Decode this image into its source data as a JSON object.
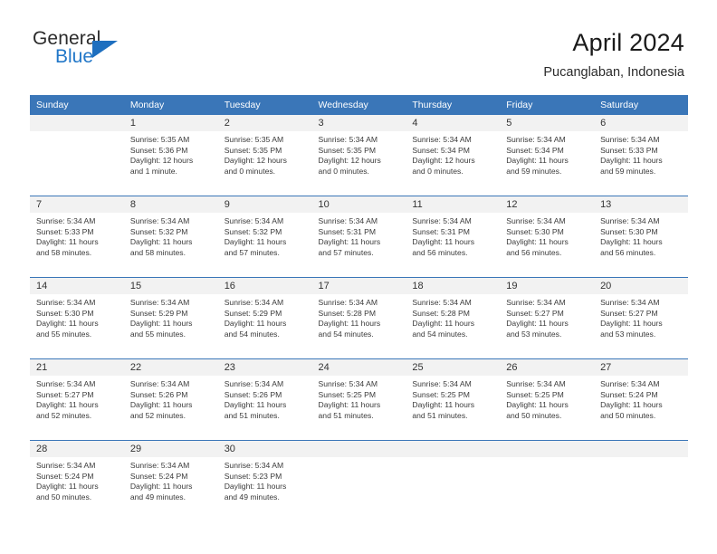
{
  "logo": {
    "word1": "General",
    "word2": "Blue",
    "triangle_color": "#1e6fbf",
    "blue_color": "#2277c8"
  },
  "header": {
    "title": "April 2024",
    "location": "Pucanglaban, Indonesia"
  },
  "theme": {
    "header_blue": "#3a76b8",
    "daynum_band": "#f2f2f2",
    "text": "#3a3a3a"
  },
  "weekday_headers": [
    "Sunday",
    "Monday",
    "Tuesday",
    "Wednesday",
    "Thursday",
    "Friday",
    "Saturday"
  ],
  "weeks": [
    [
      {
        "day": "",
        "blank": true,
        "sunrise": "",
        "sunset": "",
        "daylight1": "",
        "daylight2": ""
      },
      {
        "day": "1",
        "sunrise": "Sunrise: 5:35 AM",
        "sunset": "Sunset: 5:36 PM",
        "daylight1": "Daylight: 12 hours",
        "daylight2": "and 1 minute."
      },
      {
        "day": "2",
        "sunrise": "Sunrise: 5:35 AM",
        "sunset": "Sunset: 5:35 PM",
        "daylight1": "Daylight: 12 hours",
        "daylight2": "and 0 minutes."
      },
      {
        "day": "3",
        "sunrise": "Sunrise: 5:34 AM",
        "sunset": "Sunset: 5:35 PM",
        "daylight1": "Daylight: 12 hours",
        "daylight2": "and 0 minutes."
      },
      {
        "day": "4",
        "sunrise": "Sunrise: 5:34 AM",
        "sunset": "Sunset: 5:34 PM",
        "daylight1": "Daylight: 12 hours",
        "daylight2": "and 0 minutes."
      },
      {
        "day": "5",
        "sunrise": "Sunrise: 5:34 AM",
        "sunset": "Sunset: 5:34 PM",
        "daylight1": "Daylight: 11 hours",
        "daylight2": "and 59 minutes."
      },
      {
        "day": "6",
        "sunrise": "Sunrise: 5:34 AM",
        "sunset": "Sunset: 5:33 PM",
        "daylight1": "Daylight: 11 hours",
        "daylight2": "and 59 minutes."
      }
    ],
    [
      {
        "day": "7",
        "sunrise": "Sunrise: 5:34 AM",
        "sunset": "Sunset: 5:33 PM",
        "daylight1": "Daylight: 11 hours",
        "daylight2": "and 58 minutes."
      },
      {
        "day": "8",
        "sunrise": "Sunrise: 5:34 AM",
        "sunset": "Sunset: 5:32 PM",
        "daylight1": "Daylight: 11 hours",
        "daylight2": "and 58 minutes."
      },
      {
        "day": "9",
        "sunrise": "Sunrise: 5:34 AM",
        "sunset": "Sunset: 5:32 PM",
        "daylight1": "Daylight: 11 hours",
        "daylight2": "and 57 minutes."
      },
      {
        "day": "10",
        "sunrise": "Sunrise: 5:34 AM",
        "sunset": "Sunset: 5:31 PM",
        "daylight1": "Daylight: 11 hours",
        "daylight2": "and 57 minutes."
      },
      {
        "day": "11",
        "sunrise": "Sunrise: 5:34 AM",
        "sunset": "Sunset: 5:31 PM",
        "daylight1": "Daylight: 11 hours",
        "daylight2": "and 56 minutes."
      },
      {
        "day": "12",
        "sunrise": "Sunrise: 5:34 AM",
        "sunset": "Sunset: 5:30 PM",
        "daylight1": "Daylight: 11 hours",
        "daylight2": "and 56 minutes."
      },
      {
        "day": "13",
        "sunrise": "Sunrise: 5:34 AM",
        "sunset": "Sunset: 5:30 PM",
        "daylight1": "Daylight: 11 hours",
        "daylight2": "and 56 minutes."
      }
    ],
    [
      {
        "day": "14",
        "sunrise": "Sunrise: 5:34 AM",
        "sunset": "Sunset: 5:30 PM",
        "daylight1": "Daylight: 11 hours",
        "daylight2": "and 55 minutes."
      },
      {
        "day": "15",
        "sunrise": "Sunrise: 5:34 AM",
        "sunset": "Sunset: 5:29 PM",
        "daylight1": "Daylight: 11 hours",
        "daylight2": "and 55 minutes."
      },
      {
        "day": "16",
        "sunrise": "Sunrise: 5:34 AM",
        "sunset": "Sunset: 5:29 PM",
        "daylight1": "Daylight: 11 hours",
        "daylight2": "and 54 minutes."
      },
      {
        "day": "17",
        "sunrise": "Sunrise: 5:34 AM",
        "sunset": "Sunset: 5:28 PM",
        "daylight1": "Daylight: 11 hours",
        "daylight2": "and 54 minutes."
      },
      {
        "day": "18",
        "sunrise": "Sunrise: 5:34 AM",
        "sunset": "Sunset: 5:28 PM",
        "daylight1": "Daylight: 11 hours",
        "daylight2": "and 54 minutes."
      },
      {
        "day": "19",
        "sunrise": "Sunrise: 5:34 AM",
        "sunset": "Sunset: 5:27 PM",
        "daylight1": "Daylight: 11 hours",
        "daylight2": "and 53 minutes."
      },
      {
        "day": "20",
        "sunrise": "Sunrise: 5:34 AM",
        "sunset": "Sunset: 5:27 PM",
        "daylight1": "Daylight: 11 hours",
        "daylight2": "and 53 minutes."
      }
    ],
    [
      {
        "day": "21",
        "sunrise": "Sunrise: 5:34 AM",
        "sunset": "Sunset: 5:27 PM",
        "daylight1": "Daylight: 11 hours",
        "daylight2": "and 52 minutes."
      },
      {
        "day": "22",
        "sunrise": "Sunrise: 5:34 AM",
        "sunset": "Sunset: 5:26 PM",
        "daylight1": "Daylight: 11 hours",
        "daylight2": "and 52 minutes."
      },
      {
        "day": "23",
        "sunrise": "Sunrise: 5:34 AM",
        "sunset": "Sunset: 5:26 PM",
        "daylight1": "Daylight: 11 hours",
        "daylight2": "and 51 minutes."
      },
      {
        "day": "24",
        "sunrise": "Sunrise: 5:34 AM",
        "sunset": "Sunset: 5:25 PM",
        "daylight1": "Daylight: 11 hours",
        "daylight2": "and 51 minutes."
      },
      {
        "day": "25",
        "sunrise": "Sunrise: 5:34 AM",
        "sunset": "Sunset: 5:25 PM",
        "daylight1": "Daylight: 11 hours",
        "daylight2": "and 51 minutes."
      },
      {
        "day": "26",
        "sunrise": "Sunrise: 5:34 AM",
        "sunset": "Sunset: 5:25 PM",
        "daylight1": "Daylight: 11 hours",
        "daylight2": "and 50 minutes."
      },
      {
        "day": "27",
        "sunrise": "Sunrise: 5:34 AM",
        "sunset": "Sunset: 5:24 PM",
        "daylight1": "Daylight: 11 hours",
        "daylight2": "and 50 minutes."
      }
    ],
    [
      {
        "day": "28",
        "sunrise": "Sunrise: 5:34 AM",
        "sunset": "Sunset: 5:24 PM",
        "daylight1": "Daylight: 11 hours",
        "daylight2": "and 50 minutes."
      },
      {
        "day": "29",
        "sunrise": "Sunrise: 5:34 AM",
        "sunset": "Sunset: 5:24 PM",
        "daylight1": "Daylight: 11 hours",
        "daylight2": "and 49 minutes."
      },
      {
        "day": "30",
        "sunrise": "Sunrise: 5:34 AM",
        "sunset": "Sunset: 5:23 PM",
        "daylight1": "Daylight: 11 hours",
        "daylight2": "and 49 minutes."
      },
      {
        "day": "",
        "blank": true,
        "sunrise": "",
        "sunset": "",
        "daylight1": "",
        "daylight2": ""
      },
      {
        "day": "",
        "blank": true,
        "sunrise": "",
        "sunset": "",
        "daylight1": "",
        "daylight2": ""
      },
      {
        "day": "",
        "blank": true,
        "sunrise": "",
        "sunset": "",
        "daylight1": "",
        "daylight2": ""
      },
      {
        "day": "",
        "blank": true,
        "sunrise": "",
        "sunset": "",
        "daylight1": "",
        "daylight2": ""
      }
    ]
  ]
}
